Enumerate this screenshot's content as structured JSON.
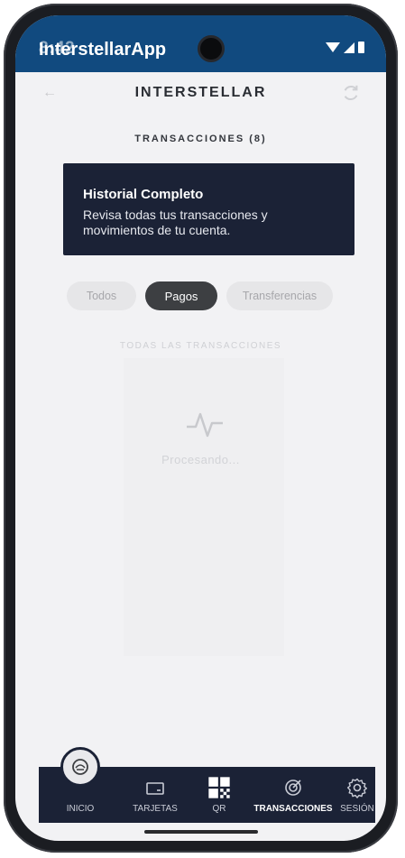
{
  "status_bar": {
    "time": "8:42"
  },
  "app_bar": {
    "title": "InterstellarApp"
  },
  "header": {
    "brand": "INTERSTELLAR"
  },
  "section": {
    "title": "TRANSACCIONES (8)"
  },
  "info_card": {
    "title": "Historial Completo",
    "description": "Revisa todas tus transacciones y movimientos de tu cuenta."
  },
  "filters": [
    {
      "label": "Todos",
      "selected": false
    },
    {
      "label": "Pagos",
      "selected": true
    },
    {
      "label": "Transferencias",
      "selected": false
    }
  ],
  "list": {
    "caption": "TODAS LAS TRANSACCIONES",
    "empty_text": "Procesando..."
  },
  "bottom_nav": [
    {
      "label": "INICIO",
      "icon": "home-icon"
    },
    {
      "label": "TARJETAS",
      "icon": "card-icon"
    },
    {
      "label": "QR",
      "icon": "qr-icon"
    },
    {
      "label": "TRANSACCIONES",
      "icon": "transactions-icon"
    },
    {
      "label": "SESIÓN",
      "icon": "gear-icon"
    }
  ],
  "colors": {
    "app_bar": "#114a7f",
    "card": "#1b2236",
    "chip_selected": "#3d3f42",
    "background": "#f2f2f4"
  }
}
